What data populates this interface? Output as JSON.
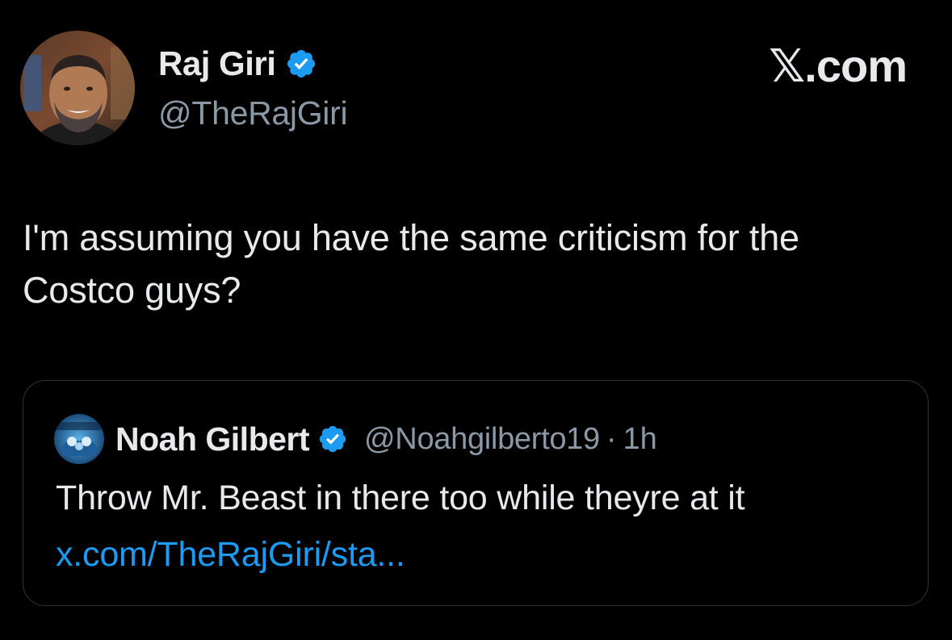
{
  "tweet": {
    "author": {
      "name": "Raj Giri",
      "handle": "@TheRajGiri",
      "verified": true,
      "avatar_icon": "person-photo-avatar"
    },
    "site_logo": "𝕏.com",
    "text": "I'm assuming you have the same criticism for the Costco guys?"
  },
  "quote": {
    "author": {
      "name": "Noah Gilbert",
      "handle": "@Noahgilberto19",
      "verified": true,
      "avatar_icon": "the-boyz-logo-avatar"
    },
    "separator": "·",
    "time": "1h",
    "text": "Throw Mr. Beast in there too while theyre at it",
    "link": "x.com/TheRajGiri/sta..."
  },
  "colors": {
    "background": "#000000",
    "primary_text": "#e7e9ea",
    "secondary_text": "#8b98a5",
    "link": "#1d9bf0",
    "verified_badge": "#1d9bf0",
    "card_border": "#2f3336"
  }
}
